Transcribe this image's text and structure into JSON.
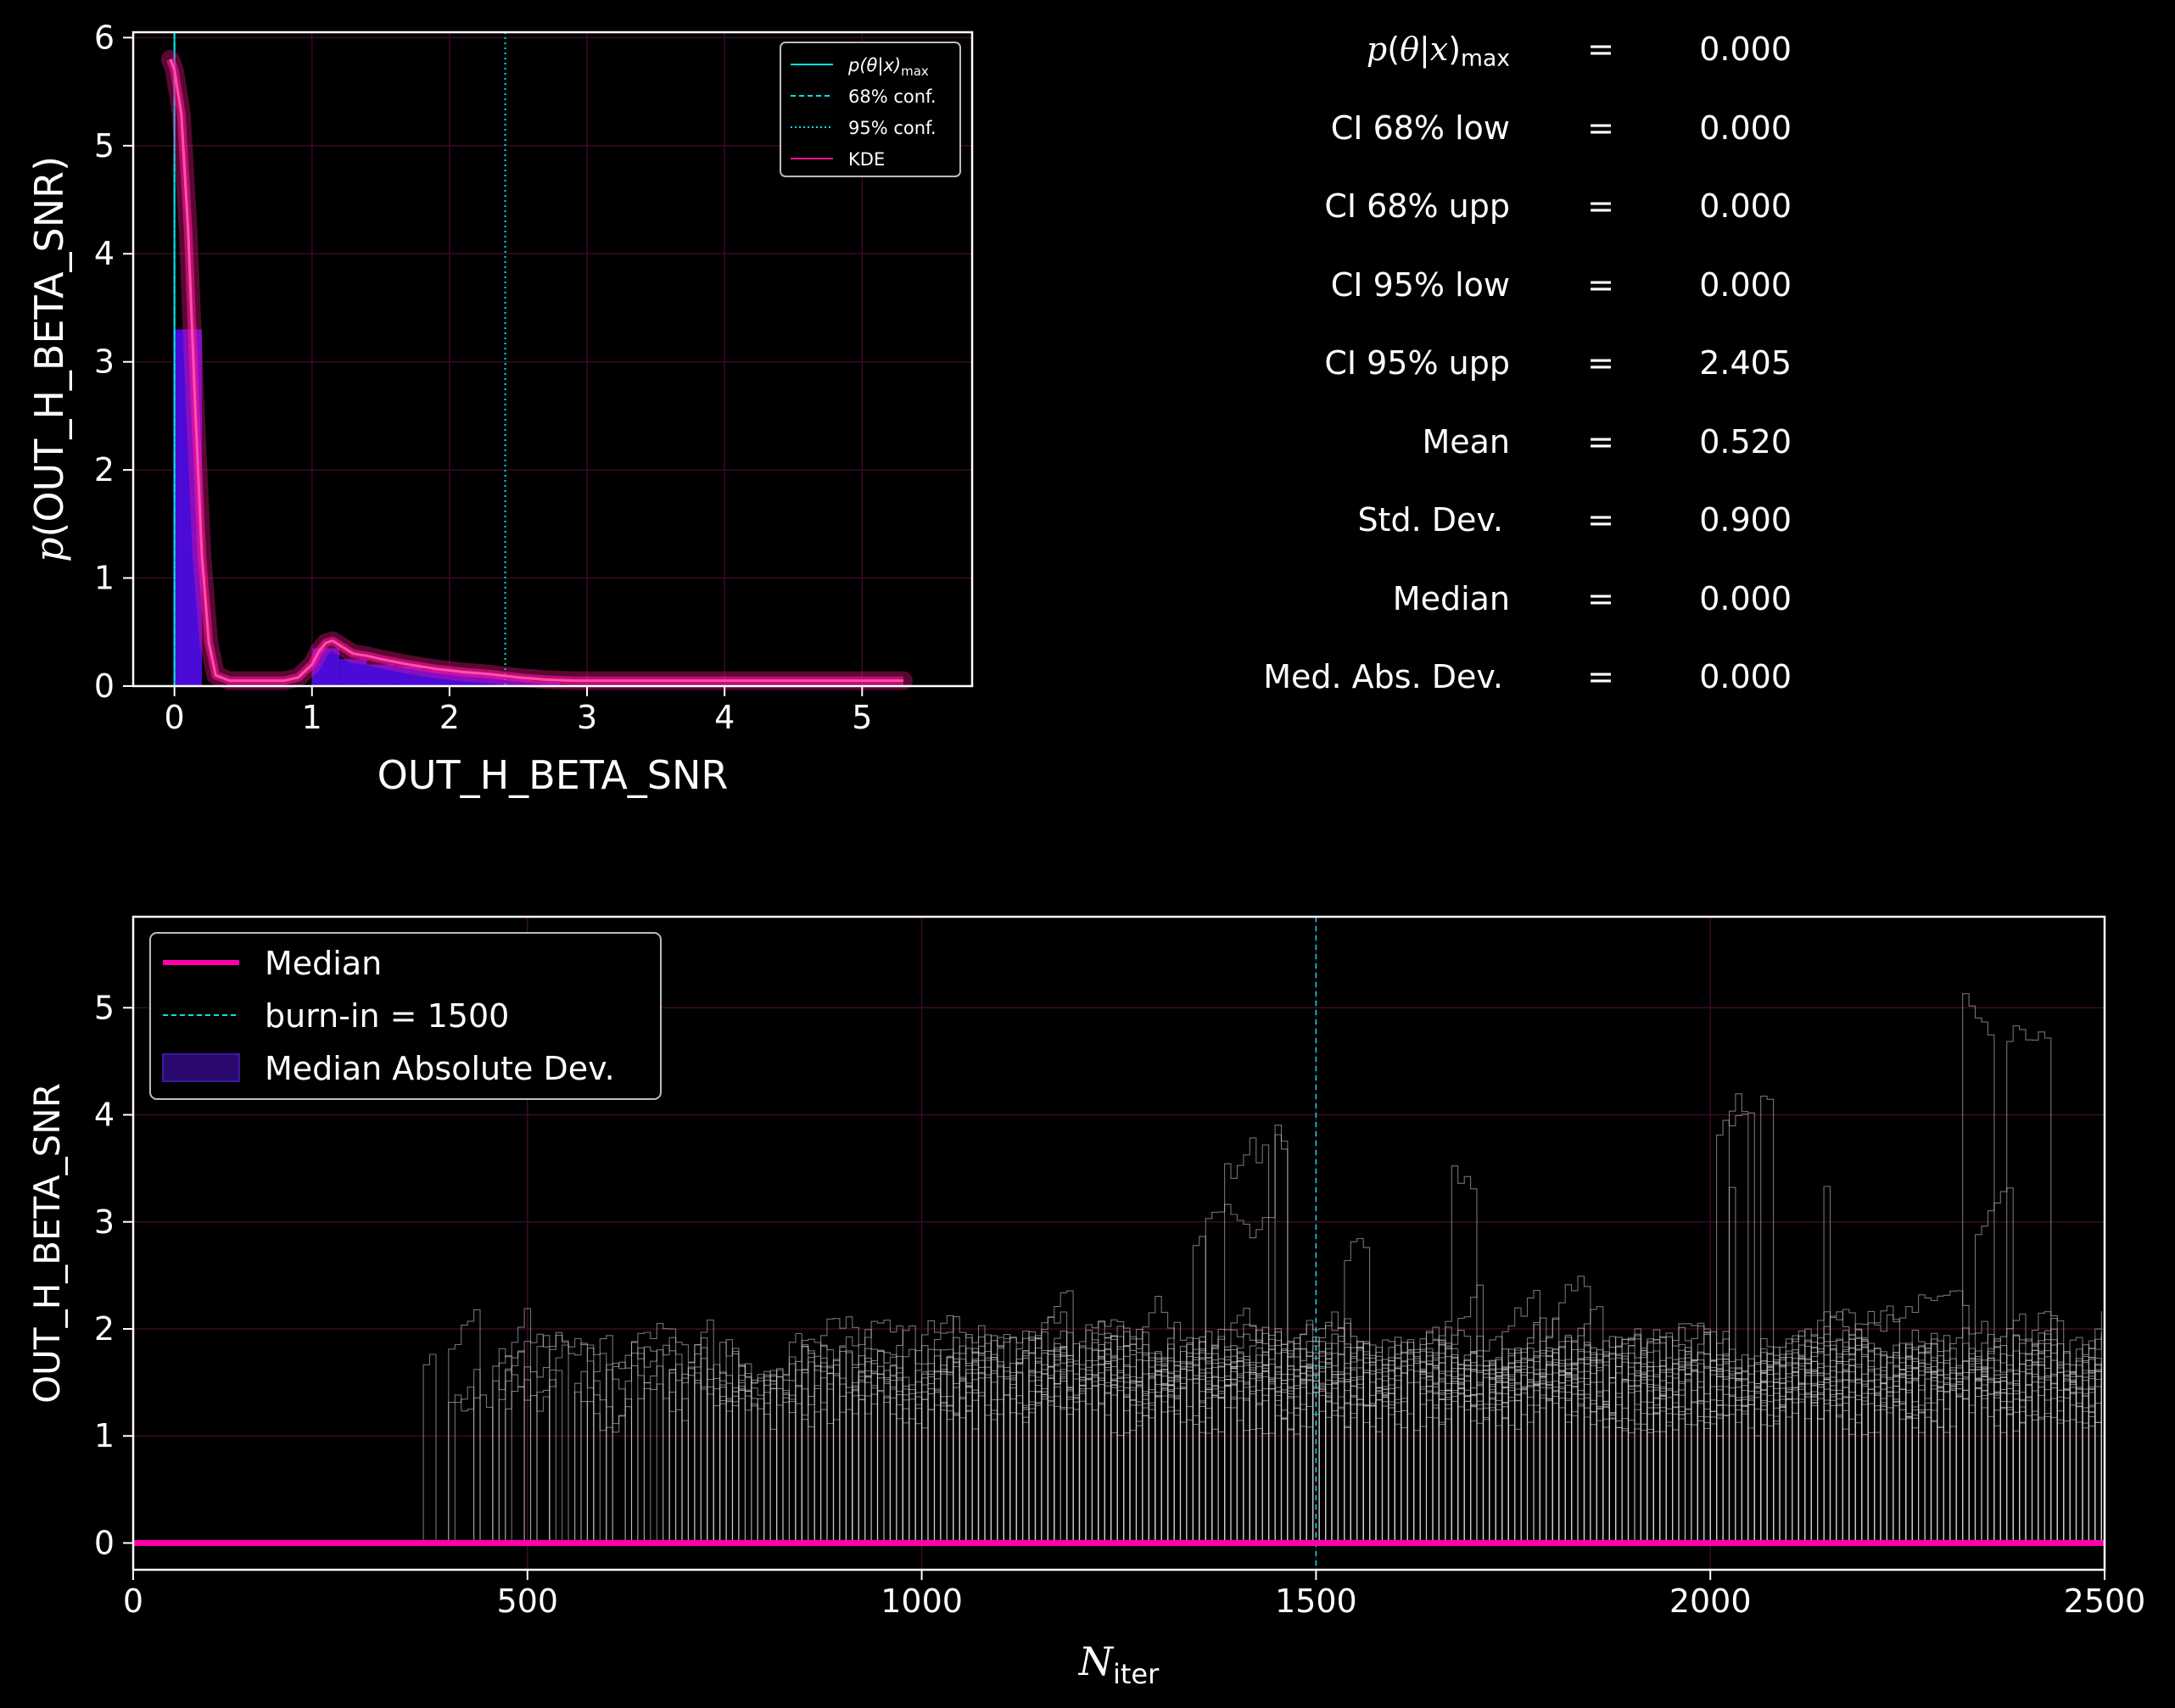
{
  "stats": [
    {
      "label": "p(θ|x)max",
      "value": "0.000"
    },
    {
      "label": "CI 68% low",
      "value": "0.000"
    },
    {
      "label": "CI 68% upp",
      "value": "0.000"
    },
    {
      "label": "CI 95% low",
      "value": "0.000"
    },
    {
      "label": "CI 95% upp",
      "value": "2.405"
    },
    {
      "label": "Mean",
      "value": "0.520"
    },
    {
      "label": "Std.  Dev.",
      "value": "0.900"
    },
    {
      "label": "Median",
      "value": "0.000"
    },
    {
      "label": "Med. Abs. Dev.",
      "value": "0.000"
    }
  ],
  "equals_sign": "=",
  "colors": {
    "background": "#000000",
    "kde": "#ff1493",
    "hist": "#4b0bd6",
    "conf_lines": "#00e5e5",
    "median": "#ff00aa",
    "mad_fill": "#2a0a6e",
    "walkers": "#cfcfcf",
    "grid": "#3a0a2a"
  },
  "chart_data": [
    {
      "type": "histogram",
      "xlabel": "OUT_H_BETA_SNR",
      "ylabel": "p(OUT_H_BETA_SNR)",
      "xlim": [
        -0.3,
        5.8
      ],
      "ylim": [
        0,
        6.05
      ],
      "xticks": [
        0,
        1,
        2,
        3,
        4,
        5
      ],
      "yticks": [
        0,
        1,
        2,
        3,
        4,
        5,
        6
      ],
      "grid": true,
      "legend_position": "upper right",
      "legend": [
        {
          "label": "p(θ|x)max",
          "style": "solid"
        },
        {
          "label": "68% conf.",
          "style": "dashed"
        },
        {
          "label": "95% conf.",
          "style": "dotted"
        },
        {
          "label": "KDE",
          "style": "solid-kde"
        }
      ],
      "bins": [
        {
          "x0": 0.0,
          "x1": 0.2,
          "height": 3.3
        },
        {
          "x0": 1.0,
          "x1": 1.2,
          "height": 0.35
        },
        {
          "x0": 1.2,
          "x1": 1.4,
          "height": 0.25
        },
        {
          "x0": 1.4,
          "x1": 1.6,
          "height": 0.2
        },
        {
          "x0": 1.6,
          "x1": 1.8,
          "height": 0.18
        },
        {
          "x0": 1.8,
          "x1": 2.0,
          "height": 0.15
        },
        {
          "x0": 2.0,
          "x1": 2.2,
          "height": 0.13
        },
        {
          "x0": 2.2,
          "x1": 2.4,
          "height": 0.1
        },
        {
          "x0": 2.4,
          "x1": 2.6,
          "height": 0.07
        },
        {
          "x0": 2.6,
          "x1": 2.8,
          "height": 0.04
        }
      ],
      "kde": {
        "x": [
          -0.03,
          0.0,
          0.05,
          0.1,
          0.15,
          0.2,
          0.25,
          0.3,
          0.4,
          0.6,
          0.8,
          0.9,
          1.0,
          1.05,
          1.1,
          1.15,
          1.2,
          1.3,
          1.4,
          1.5,
          1.7,
          1.9,
          2.1,
          2.3,
          2.5,
          2.7,
          2.9,
          3.2,
          3.6,
          4.0,
          4.5,
          5.0,
          5.3
        ],
        "y": [
          5.8,
          5.7,
          5.3,
          4.2,
          2.6,
          1.2,
          0.4,
          0.1,
          0.05,
          0.05,
          0.05,
          0.08,
          0.2,
          0.32,
          0.4,
          0.42,
          0.38,
          0.3,
          0.28,
          0.25,
          0.2,
          0.16,
          0.13,
          0.11,
          0.08,
          0.06,
          0.05,
          0.05,
          0.05,
          0.05,
          0.05,
          0.05,
          0.05
        ]
      },
      "vlines": [
        {
          "x": 0.0,
          "style": "solid",
          "name": "p(θ|x)max"
        },
        {
          "x": 0.0,
          "style": "dashed",
          "name": "68% conf."
        },
        {
          "x": 0.0,
          "style": "dotted",
          "name": "95% conf."
        },
        {
          "x": 2.405,
          "style": "dotted",
          "name": "95% conf."
        }
      ]
    },
    {
      "type": "line",
      "xlabel": "Niter",
      "ylabel": "OUT_H_BETA_SNR",
      "xlim": [
        0,
        2500
      ],
      "ylim": [
        -0.25,
        5.85
      ],
      "xticks": [
        0,
        500,
        1000,
        1500,
        2000,
        2500
      ],
      "yticks": [
        0,
        1,
        2,
        3,
        4,
        5
      ],
      "grid": true,
      "legend_position": "upper left",
      "legend": [
        {
          "label": "Median",
          "style": "thick-line"
        },
        {
          "label": "burn-in = 1500",
          "style": "dashed"
        },
        {
          "label": "Median Absolute Dev.",
          "style": "patch"
        }
      ],
      "median_value": 0.0,
      "burn_in": 1500,
      "walkers": {
        "count": 30,
        "first_activity_iter": 310,
        "typical_level_range": [
          1.0,
          2.5
        ],
        "max_value": 5.55
      }
    }
  ]
}
